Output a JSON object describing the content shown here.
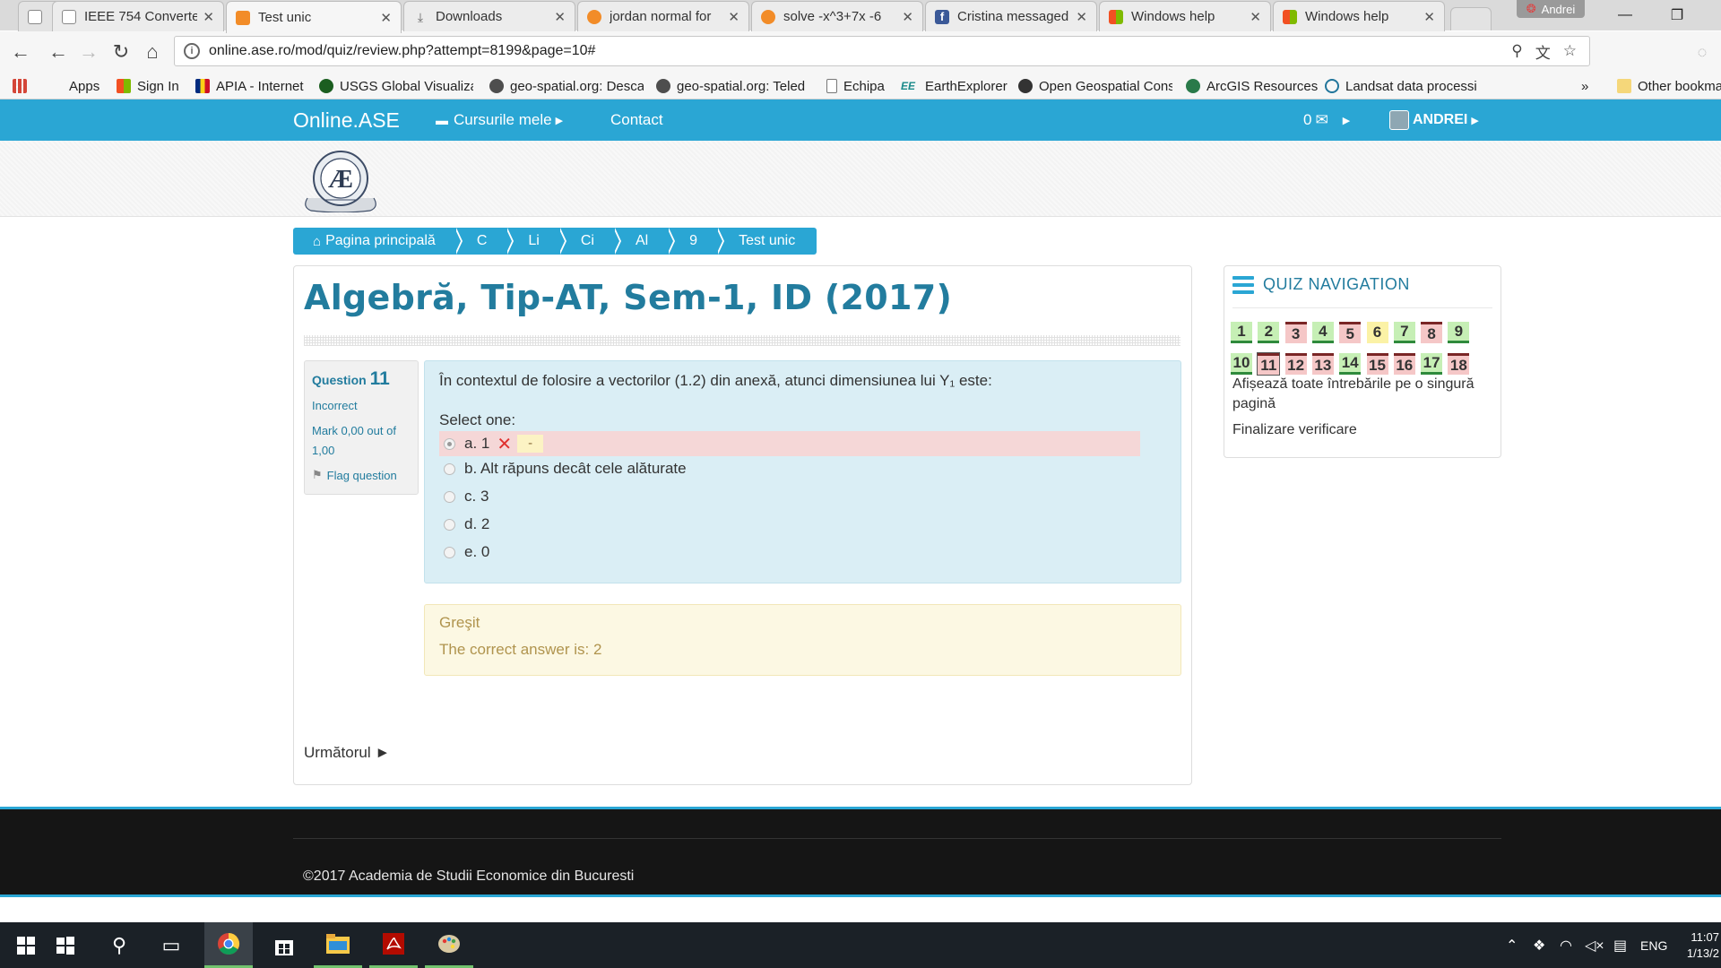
{
  "browser": {
    "profile_name": "Andrei",
    "tabs": [
      {
        "title": "IEEE 754 Converte",
        "favicon": "#8a8a8a",
        "active": false
      },
      {
        "title": "Test unic",
        "favicon": "#f28c28",
        "active": true
      },
      {
        "title": "Downloads",
        "favicon": "#666666",
        "active": false
      },
      {
        "title": "jordan normal for",
        "favicon": "#f28c28",
        "active": false
      },
      {
        "title": "solve -x^3+7x -6",
        "favicon": "#f28c28",
        "active": false
      },
      {
        "title": "Cristina messaged",
        "favicon": "#3b5998",
        "active": false
      },
      {
        "title": "Windows help",
        "favicon": "#f25022",
        "active": false
      },
      {
        "title": "Windows help",
        "favicon": "#f25022",
        "active": false
      }
    ],
    "url": "online.ase.ro/mod/quiz/review.php?attempt=8199&page=10#",
    "bookmarks": [
      {
        "label": "Apps",
        "color": "#d44638"
      },
      {
        "label": "Sign In",
        "color": "#f25022"
      },
      {
        "label": "APIA - Internet",
        "color": "#002b7f"
      },
      {
        "label": "USGS Global Visualiza",
        "color": "#1b5e20"
      },
      {
        "label": "geo-spatial.org: Desca",
        "color": "#4e4e4e"
      },
      {
        "label": "geo-spatial.org: Teled",
        "color": "#4e4e4e"
      },
      {
        "label": "Echipa",
        "color": "#ffffff"
      },
      {
        "label": "EarthExplorer",
        "color": "#1a8a8a"
      },
      {
        "label": "Open Geospatial Cons",
        "color": "#333333"
      },
      {
        "label": "ArcGIS Resources",
        "color": "#2a7a4a"
      },
      {
        "label": "Landsat data processi",
        "color": "#21759b"
      }
    ],
    "bookmarks_more": "»",
    "other_bookmarks": "Other bookma"
  },
  "site": {
    "brand": "Online.ASE",
    "nav_courses": "Cursurile mele",
    "nav_contact": "Contact",
    "messages_count": "0",
    "user_name": "ANDREI",
    "accent": "#2aa6d4",
    "title_color": "#227c9e"
  },
  "breadcrumb": [
    "Pagina principală",
    "C",
    "Li",
    "Ci",
    "Al",
    "9",
    "Test unic"
  ],
  "page": {
    "title": "Algebră, Tip-AT, Sem-1, ID (2017)"
  },
  "question": {
    "label": "Question",
    "number": "11",
    "state": "Incorrect",
    "mark": "Mark 0,00 out of 1,00",
    "flag_label": "Flag question",
    "text": "În contextul de folosire a vectorilor (1.2) din anexă, atunci dimensiunea lui Y₁ este:",
    "select_one": "Select one:",
    "answers": [
      "a. 1",
      "b. Alt răpuns decât cele alăturate",
      "c. 3",
      "d. 2",
      "e. 0"
    ],
    "selected_index": 0,
    "wrong_mark": "✕",
    "minus": "-",
    "feedback_state": "Greşit",
    "feedback_answer": "The correct answer is: 2",
    "next_label": "Următorul ►"
  },
  "quiz_nav": {
    "title": "QUIZ NAVIGATION",
    "buttons_row1": [
      "1",
      "2",
      "3",
      "4",
      "5",
      "6",
      "7",
      "8",
      "9"
    ],
    "buttons_row2": [
      "10",
      "11",
      "12",
      "13",
      "14",
      "15",
      "16",
      "17",
      "18"
    ],
    "states_row1": [
      "c",
      "c",
      "w",
      "c",
      "w",
      "p",
      "c",
      "w",
      "c"
    ],
    "states_row2": [
      "c",
      "w",
      "w",
      "w",
      "c",
      "w",
      "w",
      "c",
      "w"
    ],
    "show_all": "Afișează toate întrebările pe o singură pagină",
    "finish": "Finalizare verificare"
  },
  "footer": {
    "copyright": "©2017 Academia de Studii Economice din Bucuresti"
  },
  "taskbar": {
    "lang": "ENG",
    "time": "11:07",
    "date": "1/13/2"
  }
}
